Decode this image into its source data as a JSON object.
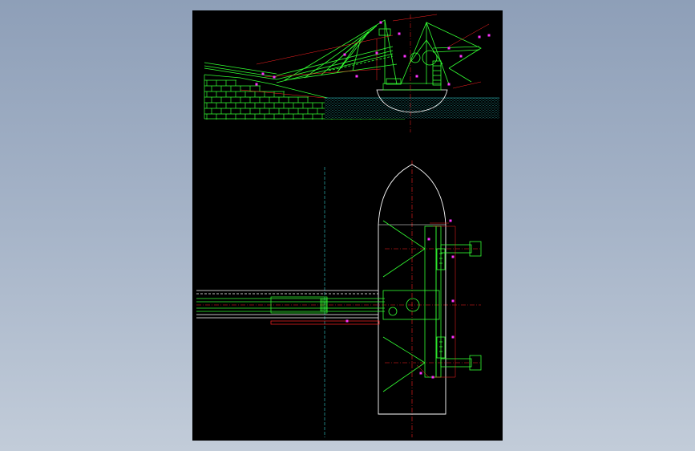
{
  "viewer": {
    "background_top": "#8e9fb8",
    "background_bottom": "#c2ccd9",
    "sheet_color": "#000000"
  },
  "drawing": {
    "views": [
      "elevation-view",
      "plan-view"
    ],
    "colors": {
      "structure": "#33ff33",
      "dimension": "#ff2222",
      "hull": "#ffffff",
      "balloon": "#ff33ff",
      "water": "#33cccc",
      "centerline": "#33cccc"
    },
    "elements": {
      "truss-booms": 2,
      "brick-embankment": 1,
      "pontoon-hull": 1,
      "conveyor": 1,
      "anchor-struts": 4
    }
  }
}
